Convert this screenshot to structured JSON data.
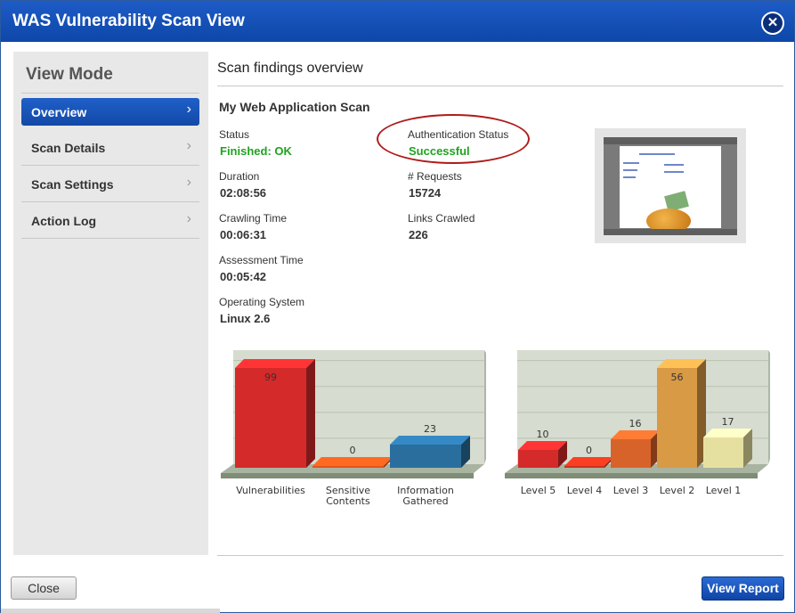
{
  "window": {
    "title": "WAS Vulnerability Scan View",
    "close_icon": "close-icon"
  },
  "sidebar": {
    "title": "View Mode",
    "items": [
      {
        "label": "Overview",
        "active": true
      },
      {
        "label": "Scan Details",
        "active": false
      },
      {
        "label": "Scan Settings",
        "active": false
      },
      {
        "label": "Action Log",
        "active": false
      }
    ],
    "chevron": "›"
  },
  "main": {
    "heading": "Scan findings overview",
    "scan_name": "My Web Application Scan",
    "fields": [
      {
        "label": "Status",
        "value": "Finished: OK",
        "status": "good"
      },
      {
        "label": "Authentication Status",
        "value": "Successful",
        "status": "good"
      },
      {
        "label": "Duration",
        "value": "02:08:56"
      },
      {
        "label": "# Requests",
        "value": "15724"
      },
      {
        "label": "Crawling Time",
        "value": "00:06:31"
      },
      {
        "label": "Links Crawled",
        "value": "226"
      },
      {
        "label": "Assessment Time",
        "value": "00:05:42"
      },
      {
        "label": "Operating System",
        "value": "Linux 2.6"
      }
    ]
  },
  "chart_data": [
    {
      "type": "bar",
      "categories": [
        "Vulnerabilities",
        "Sensitive\nContents",
        "Information\nGathered"
      ],
      "values": [
        99,
        0,
        23
      ],
      "ylim": [
        0,
        99
      ],
      "grid": true,
      "colors": [
        "#d42a2a",
        "#e0551c",
        "#2a6e9e"
      ]
    },
    {
      "type": "bar",
      "categories": [
        "Level 5",
        "Level 4",
        "Level 3",
        "Level 2",
        "Level 1"
      ],
      "values": [
        10,
        0,
        16,
        56,
        17
      ],
      "ylim": [
        0,
        56
      ],
      "grid": true,
      "colors": [
        "#d42a2a",
        "#c9321c",
        "#d8632a",
        "#d89a45",
        "#e6e0a0"
      ]
    }
  ],
  "footer": {
    "close_label": "Close",
    "report_label": "View Report"
  },
  "colors": {
    "brand": "#1a53b8",
    "ok": "#1fa31f",
    "highlight": "#b01a1a"
  }
}
